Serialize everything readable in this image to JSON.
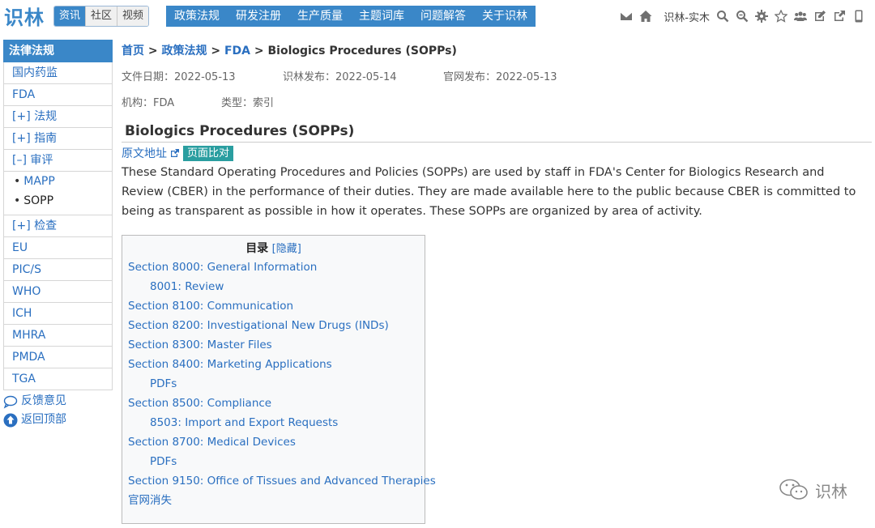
{
  "header": {
    "brand": "识林",
    "segments": [
      {
        "label": "资讯",
        "active": true
      },
      {
        "label": "社区",
        "active": false
      },
      {
        "label": "视频",
        "active": false
      }
    ],
    "nav": [
      "政策法规",
      "研发注册",
      "生产质量",
      "主题词库",
      "问题解答",
      "关于识林"
    ],
    "user": "识林-实木",
    "icons": [
      "mail-icon",
      "home-icon",
      "search-icon",
      "zoom-search-icon",
      "gear-icon",
      "star-icon",
      "users-icon",
      "edit-icon",
      "share-icon",
      "mobile-icon"
    ]
  },
  "sidebar": {
    "title": "法律法规",
    "items": [
      {
        "label": "国内药监",
        "type": "item"
      },
      {
        "label": "FDA",
        "type": "item"
      },
      {
        "label": "[+] 法规",
        "type": "item"
      },
      {
        "label": "[+] 指南",
        "type": "item"
      },
      {
        "label": "[–] 审评",
        "type": "item"
      },
      {
        "label": "MAPP",
        "type": "sub"
      },
      {
        "label": "SOPP",
        "type": "sub"
      },
      {
        "label": "[+] 检查",
        "type": "item"
      },
      {
        "label": "EU",
        "type": "item"
      },
      {
        "label": "PIC/S",
        "type": "item"
      },
      {
        "label": "WHO",
        "type": "item"
      },
      {
        "label": "ICH",
        "type": "item"
      },
      {
        "label": "MHRA",
        "type": "item"
      },
      {
        "label": "PMDA",
        "type": "item"
      },
      {
        "label": "TGA",
        "type": "item"
      }
    ],
    "feedback": "反馈意见",
    "back_to_top": "返回顶部"
  },
  "breadcrumb": {
    "home": "首页",
    "sep": " > ",
    "policy": "政策法规",
    "fda": "FDA",
    "current": "Biologics Procedures (SOPPs)"
  },
  "meta": {
    "file_date": "文件日期：2022-05-13",
    "shilin_pub": "识林发布：2022-05-14",
    "official_pub": "官网发布：2022-05-13",
    "agency": "机构：FDA",
    "type": "类型：索引"
  },
  "article": {
    "title": "Biologics Procedures (SOPPs)",
    "source_link": "原文地址",
    "compare_badge": "页面比对",
    "intro": "These Standard Operating Procedures and Policies (SOPPs) are used by staff in FDA's Center for Biologics Research and Review (CBER) in the performance of their duties. They are made available here to the public because CBER is committed to being as transparent as possible in how it operates. These SOPPs are organized by area of activity."
  },
  "toc": {
    "title": "目录",
    "toggle": "[隐藏]",
    "items": [
      {
        "label": "Section 8000: General Information",
        "level": 1
      },
      {
        "label": "8001: Review",
        "level": 2
      },
      {
        "label": "Section 8100: Communication",
        "level": 1
      },
      {
        "label": "Section 8200: Investigational New Drugs (INDs)",
        "level": 1
      },
      {
        "label": "Section 8300: Master Files",
        "level": 1
      },
      {
        "label": "Section 8400: Marketing Applications",
        "level": 1
      },
      {
        "label": "PDFs",
        "level": 2
      },
      {
        "label": "Section 8500: Compliance",
        "level": 1
      },
      {
        "label": "8503: Import and Export Requests",
        "level": 2
      },
      {
        "label": "Section 8700: Medical Devices",
        "level": 1
      },
      {
        "label": "PDFs",
        "level": 2
      },
      {
        "label": "Section 9150: Office of Tissues and Advanced Therapies",
        "level": 1
      },
      {
        "label": "官网消失",
        "level": 1
      }
    ]
  },
  "watermark": "识林",
  "colors": {
    "accent": "#3a87c8",
    "link": "#2a6fc0",
    "badge": "#2a9ea0"
  }
}
